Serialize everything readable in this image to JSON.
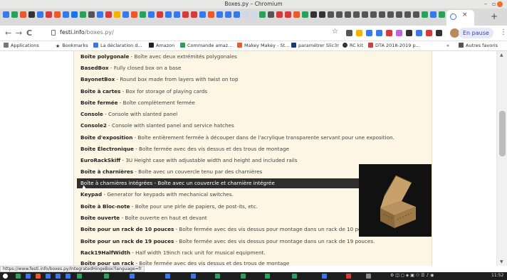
{
  "window": {
    "title": "Boxes.py – Chromium",
    "minimize": "–",
    "maximize": "▫"
  },
  "tab": {
    "close": "×",
    "new": "+"
  },
  "toolbar": {
    "back": "←",
    "forward": "→",
    "reload": "C",
    "url_host": "festi.info",
    "url_path": "/boxes.py/",
    "star": "☆",
    "profile_button": "En pause",
    "menu": "⋮"
  },
  "bookmarks": {
    "items": [
      "Applications",
      "Bookmarks",
      "La déclaration d...",
      "Amazon",
      "Commande amaz...",
      "Makey Makey - St...",
      "paramétrer Slic3r",
      "RC kit",
      "DTA 2018-2019 p...",
      "»",
      "Autres favoris"
    ]
  },
  "list": [
    {
      "name": "Boîte polygonale",
      "desc": " - Boîte avec deux extrémités polygonales"
    },
    {
      "name": "BasedBox",
      "desc": " - Fully closed box on a base"
    },
    {
      "name": "BayonetBox",
      "desc": " - Round box made from layers with twist on top"
    },
    {
      "name": "Boîte à cartes",
      "desc": " - Box for storage of playing cards"
    },
    {
      "name": "Boîte fermée",
      "desc": " - Boîte complètement fermée"
    },
    {
      "name": "Console",
      "desc": " - Console with slanted panel"
    },
    {
      "name": "Console2",
      "desc": " - Console with slanted panel and service hatches"
    },
    {
      "name": "Boîte d'exposition",
      "desc": " - Boîte entièrement fermée à découper dans de l'acrylique transparente servant pour une exposition."
    },
    {
      "name": "Boîte Électronique",
      "desc": " - Boîte fermée avec des vis dessus et des trous de montage"
    },
    {
      "name": "EuroRackSkiff",
      "desc": " - 3U Height case with adjustable width and height and included rails"
    },
    {
      "name": "Boîte à charnières",
      "desc": " - Boîte avec un couvercle tenu par des charnières"
    },
    {
      "name": "Boîte à charnières intégrées",
      "desc": " - Boîte avec un couvercle et charnière intégrée"
    },
    {
      "name": "Keypad",
      "desc": " - Generator for keypads with mechanical switches."
    },
    {
      "name": "Boîte à Bloc-note",
      "desc": " - Boîte pour une pirle de papiers, de post-its, etc."
    },
    {
      "name": "Boîte ouverte",
      "desc": " - Boîte ouverte en haut et devant"
    },
    {
      "name": "Boîte pour un rack de 10 pouces",
      "desc": " - Boîte fermée avec des vis dessus pour montage dans un rack de 10 pouces."
    },
    {
      "name": "Boîte pour un rack de 19 pouces",
      "desc": " - Boîte fermée avec des vis dessus pour montage dans un rack de 19 pouces."
    },
    {
      "name": "Rack19HalfWidth",
      "desc": " - Half width 19inch rack unit for musical equipment."
    },
    {
      "name": "Boîte pour un rack",
      "desc": " - Boîte fermée avec des vis dessus et des trous de montage"
    }
  ],
  "status_url": "https://www.festi.info/boxes.py/IntegratedHingeBox?language=fr",
  "taskbar": {
    "time": "11:52"
  }
}
